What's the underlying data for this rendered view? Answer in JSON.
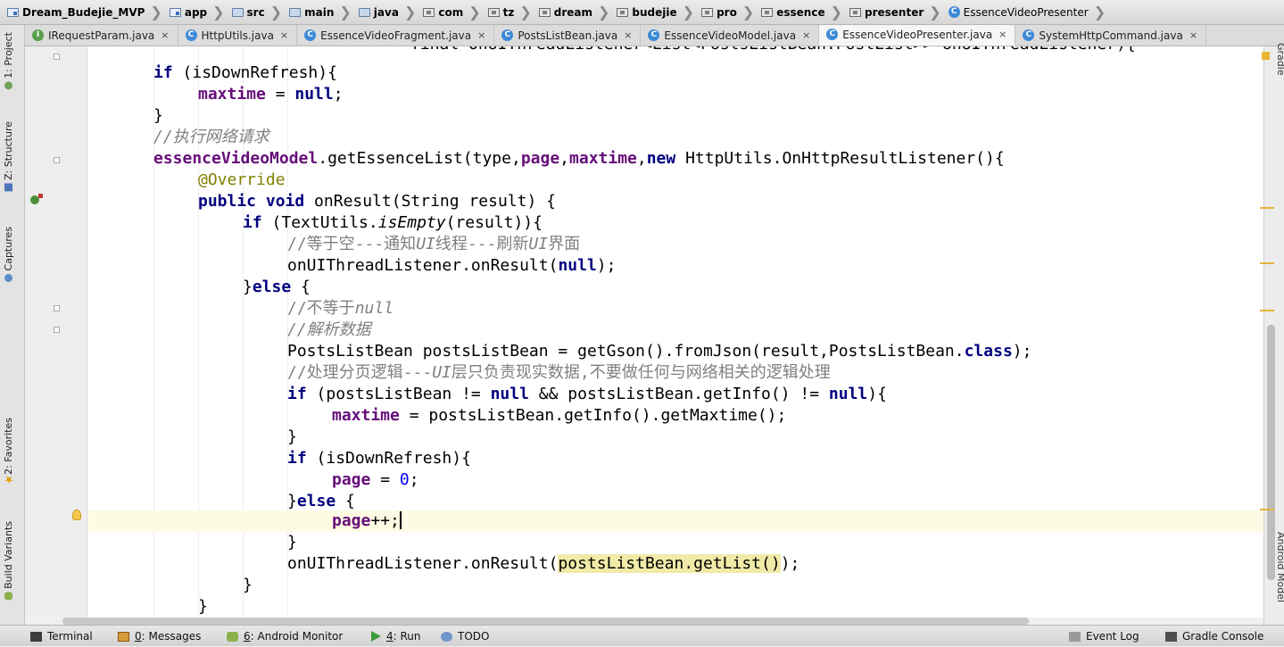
{
  "breadcrumb": [
    {
      "label": "Dream_Budejie_MVP",
      "icon": "project-folder-icon"
    },
    {
      "label": "app",
      "icon": "module-folder-icon"
    },
    {
      "label": "src",
      "icon": "folder-icon"
    },
    {
      "label": "main",
      "icon": "folder-icon"
    },
    {
      "label": "java",
      "icon": "folder-icon"
    },
    {
      "label": "com",
      "icon": "package-icon"
    },
    {
      "label": "tz",
      "icon": "package-icon"
    },
    {
      "label": "dream",
      "icon": "package-icon"
    },
    {
      "label": "budejie",
      "icon": "package-icon"
    },
    {
      "label": "pro",
      "icon": "package-icon"
    },
    {
      "label": "essence",
      "icon": "package-icon"
    },
    {
      "label": "presenter",
      "icon": "package-icon"
    },
    {
      "label": "EssenceVideoPresenter",
      "icon": "class-icon"
    }
  ],
  "tabs": [
    {
      "label": "IRequestParam.java",
      "icon": "interface-icon",
      "active": false
    },
    {
      "label": "HttpUtils.java",
      "icon": "class-icon",
      "active": false
    },
    {
      "label": "EssenceVideoFragment.java",
      "icon": "class-icon",
      "active": false
    },
    {
      "label": "PostsListBean.java",
      "icon": "class-icon",
      "active": false
    },
    {
      "label": "EssenceVideoModel.java",
      "icon": "class-icon",
      "active": false
    },
    {
      "label": "EssenceVideoPresenter.java",
      "icon": "class-icon",
      "active": true
    },
    {
      "label": "SystemHttpCommand.java",
      "icon": "class-icon",
      "active": false
    }
  ],
  "tab_close_glyph": "×",
  "left_tools": [
    {
      "label": "1: Project",
      "icon": "project-tool-icon"
    },
    {
      "label": "Z: Structure",
      "icon": "structure-tool-icon"
    },
    {
      "label": "Captures",
      "icon": "captures-tool-icon"
    },
    {
      "label": "2: Favorites",
      "icon": "favorites-star-icon"
    },
    {
      "label": "Build Variants",
      "icon": "android-icon"
    }
  ],
  "right_tools": [
    "Gradle",
    "Android Model"
  ],
  "code": {
    "partial_top": "final OnUIThreadListener<List<PostsListBean.PostList>> onUIThreadListener){",
    "l01_kw": "if",
    "l01_rest": " (isDownRefresh){",
    "l02_fld": "maxtime",
    "l02_mid": " = ",
    "l02_kw": "null",
    "l02_end": ";",
    "l03": "}",
    "l04_cmt": "//执行网络请求",
    "l05_fld": "essenceVideoModel",
    "l05_a": ".getEssenceList(type,",
    "l05_page": "page",
    "l05_c": ",",
    "l05_max": "maxtime",
    "l05_d": ",",
    "l05_new": "new",
    "l05_e": " HttpUtils.OnHttpResultListener(){",
    "l06_ann": "@Override",
    "l07_kw": "public void",
    "l07_rest": " onResult(String result) {",
    "l08_kw": "if",
    "l08_a": " (TextUtils.",
    "l08_it": "isEmpty",
    "l08_b": "(result)){",
    "l09_c1": "//等于空---通知",
    "l09_ui1": "UI",
    "l09_c2": "线程---刷新",
    "l09_ui2": "UI",
    "l09_c3": "界面",
    "l10_a": "onUIThreadListener.onResult(",
    "l10_kw": "null",
    "l10_b": ");",
    "l11_a": "}",
    "l11_kw": "else",
    "l11_b": " {",
    "l12_c1": "//不等于",
    "l12_c2": "null",
    "l13_cmt": "//解析数据",
    "l14_a": "PostsListBean postsListBean = getGson().fromJson(result,PostsListBean.",
    "l14_kw": "class",
    "l14_b": ");",
    "l15_c1": "//处理分页逻辑---",
    "l15_ui": "UI",
    "l15_c2": "层只负责现实数据,不要做任何与网络相关的逻辑处理",
    "l16_kw": "if",
    "l16_a": " (postsListBean != ",
    "l16_kw2": "null",
    "l16_b": " && postsListBean.getInfo() != ",
    "l16_kw3": "null",
    "l16_c": "){",
    "l17_fld": "maxtime",
    "l17_rest": " = postsListBean.getInfo().getMaxtime();",
    "l18": "}",
    "l19_kw": "if",
    "l19_rest": " (isDownRefresh){",
    "l20_fld": "page",
    "l20_mid": " = ",
    "l20_num": "0",
    "l20_end": ";",
    "l21_a": "}",
    "l21_kw": "else",
    "l21_b": " {",
    "l22_fld": "page",
    "l22_rest": "++;",
    "l23": "}",
    "l24_a": "onUIThreadListener.onResult(",
    "l24_hl": "postsListBean.getList()",
    "l24_b": ");",
    "l25": "}",
    "l26": "}",
    "partial_bottom": "});"
  },
  "bottom_tools": [
    {
      "label": "Terminal",
      "icon": "terminal-icon"
    },
    {
      "key": "0",
      "label": ": Messages",
      "icon": "messages-icon"
    },
    {
      "key": "6",
      "label": ": Android Monitor",
      "icon": "android-icon"
    },
    {
      "key": "4",
      "label": ": Run",
      "icon": "run-icon"
    },
    {
      "label": "TODO",
      "icon": "todo-icon"
    },
    {
      "label": "Event Log",
      "icon": "event-log-icon"
    },
    {
      "label": "Gradle Console",
      "icon": "gradle-console-icon"
    }
  ],
  "colors": {
    "keyword": "#000080",
    "field": "#660e7a",
    "comment": "#808080",
    "annotation": "#808000",
    "number": "#0000ff",
    "caret_line": "#fdfbe3",
    "highlight": "#f1eaa8"
  }
}
